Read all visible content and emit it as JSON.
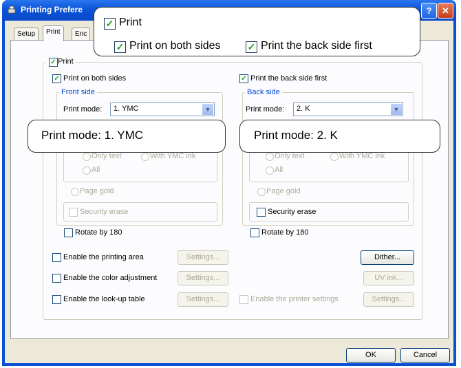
{
  "window": {
    "title": "Printing Prefere",
    "help_glyph": "?",
    "close_glyph": "✕"
  },
  "tabs": [
    {
      "label": "Setup",
      "active": false
    },
    {
      "label": "Print",
      "active": true
    },
    {
      "label": "Enc",
      "active": false
    }
  ],
  "print_group": {
    "label": "Print",
    "checked": true,
    "both_sides": {
      "label": "Print on both sides",
      "checked": true
    },
    "back_first": {
      "label": "Print the back side first",
      "checked": true
    },
    "front": {
      "title": "Front side",
      "mode_label": "Print mode:",
      "mode_value": "1. YMC",
      "radio_only_text": "Only text",
      "radio_with_ymc": "With YMC ink",
      "radio_all": "All",
      "page_gold": "Page gold",
      "security_erase": "Security erase",
      "rotate": "Rotate by 180"
    },
    "back": {
      "title": "Back side",
      "mode_label": "Print mode:",
      "mode_value": "2. K",
      "radio_only_text": "Only text",
      "radio_with_ymc": "With YMC ink",
      "radio_all": "All",
      "page_gold": "Page gold",
      "security_erase": "Security erase",
      "rotate": "Rotate by 180"
    }
  },
  "options": {
    "printing_area": "Enable the printing area",
    "color_adjustment": "Enable the color adjustment",
    "lookup_table": "Enable the look-up table",
    "printer_settings": "Enable the printer settings",
    "settings_btn": "Settings...",
    "dither_btn": "Dither...",
    "uv_ink_btn": "UV ink..."
  },
  "dialog_buttons": {
    "ok": "OK",
    "cancel": "Cancel"
  },
  "callouts": {
    "top_print": "Print",
    "top_both": "Print on both sides",
    "top_back_first": "Print the back side first",
    "front_mode": "Print mode:  1. YMC",
    "back_mode": "Print mode:  2. K"
  },
  "colors": {
    "titlebar": "#0b54d8",
    "face": "#ece9d8",
    "check": "#21a121",
    "group_title": "#0046d5"
  }
}
